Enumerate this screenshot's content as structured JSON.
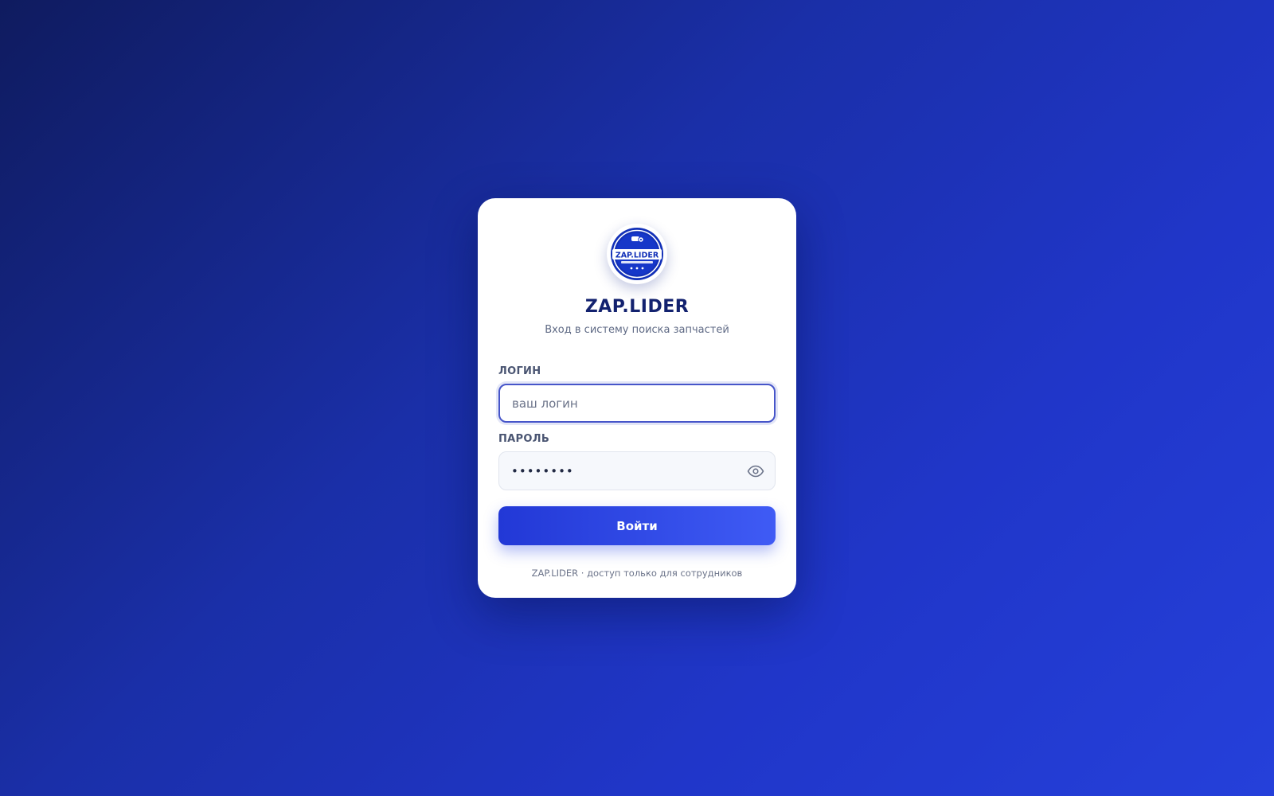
{
  "brand": {
    "logo_text": "ZAP.LIDER",
    "title": "ZAP.LIDER",
    "subtitle": "Вход в систему поиска запчастей"
  },
  "form": {
    "login": {
      "label": "ЛОГИН",
      "placeholder": "ваш логин",
      "value": ""
    },
    "password": {
      "label": "ПАРОЛЬ",
      "value": "••••••••",
      "toggle_icon": "eye-icon"
    },
    "submit_label": "Войти"
  },
  "footer": {
    "note": "ZAP.LIDER · доступ только для сотрудников"
  },
  "colors": {
    "accent": "#2238d6",
    "brand_dark": "#13226f",
    "focus_border": "#4655c9"
  }
}
